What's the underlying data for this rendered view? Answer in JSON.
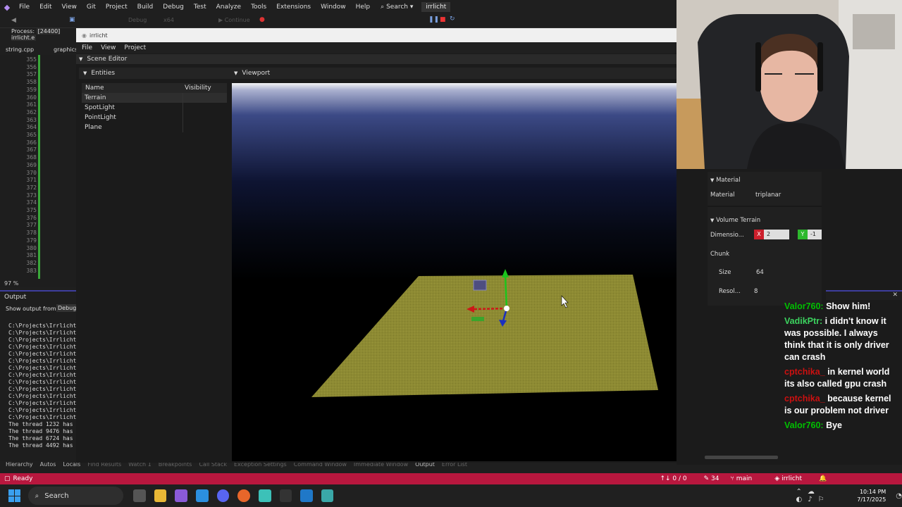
{
  "vs": {
    "menu": [
      "File",
      "Edit",
      "View",
      "Git",
      "Project",
      "Build",
      "Debug",
      "Test",
      "Analyze",
      "Tools",
      "Extensions",
      "Window",
      "Help"
    ],
    "search_label": "Search",
    "solution_name": "irrlicht",
    "config": "Debug",
    "platform": "x64",
    "continue_label": "Continue",
    "process_label": "Process:",
    "process_value": "[24400] irrlicht.e",
    "tabs": [
      "string.cpp",
      "graphics"
    ],
    "line_numbers": [
      "355",
      "356",
      "357",
      "358",
      "359",
      "360",
      "361",
      "362",
      "363",
      "364",
      "365",
      "366",
      "367",
      "368",
      "369",
      "370",
      "371",
      "372",
      "373",
      "374",
      "375",
      "376",
      "377",
      "378",
      "379",
      "380",
      "381",
      "382",
      "383"
    ],
    "zoom": "97 %",
    "output": {
      "title": "Output",
      "show_from_label": "Show output from:",
      "show_from_value": "Debug",
      "lines": [
        "C:\\Projects\\Irrlicht",
        "C:\\Projects\\Irrlicht",
        "C:\\Projects\\Irrlicht",
        "C:\\Projects\\Irrlicht",
        "C:\\Projects\\Irrlicht",
        "C:\\Projects\\Irrlicht",
        "C:\\Projects\\Irrlicht",
        "C:\\Projects\\Irrlicht",
        "C:\\Projects\\Irrlicht",
        "C:\\Projects\\Irrlicht",
        "C:\\Projects\\Irrlicht",
        "C:\\Projects\\Irrlicht",
        "C:\\Projects\\Irrlicht",
        "C:\\Projects\\Irrlicht",
        "The thread 1232 has",
        "The thread 9476 has",
        "The thread 6724 has",
        "The thread 4492 has"
      ]
    },
    "bottom_tabs": [
      "Hierarchy",
      "Autos",
      "Locals",
      "Find Results",
      "Watch 1",
      "Breakpoints",
      "Call Stack",
      "Exception Settings",
      "Command Window",
      "Immediate Window",
      "Output",
      "Error List"
    ],
    "status": {
      "ready": "Ready",
      "changes": "0 / 0",
      "pencil_count": "34",
      "branch": "main",
      "repo": "irrlicht"
    }
  },
  "app": {
    "title": "irrlicht",
    "menu": [
      "File",
      "View",
      "Project"
    ],
    "scene_editor": "Scene Editor",
    "entities": {
      "title": "Entities",
      "col_name": "Name",
      "col_visibility": "Visibility",
      "rows": [
        "Terrain",
        "SpotLight",
        "PointLight",
        "Plane"
      ]
    },
    "viewport_title": "Viewport"
  },
  "props": {
    "material_section": "Material",
    "material_label": "Material",
    "material_value": "triplanar",
    "volume_section": "Volume Terrain",
    "dimension_label": "Dimensio...",
    "dim_x_label": "X",
    "dim_x_value": "2",
    "dim_y_label": "Y",
    "dim_y_value": "-1",
    "chunk_label": "Chunk",
    "size_label": "Size",
    "size_value": "64",
    "resol_label": "Resol...",
    "resol_value": "8"
  },
  "chat": [
    {
      "user": "Valor760:",
      "color": "#00c000",
      "text": "Show him!"
    },
    {
      "user": "VadikPtr:",
      "color": "#3cd35f",
      "text": "i didn't know it was possible. I always think that it is only driver can crash"
    },
    {
      "user": "cptchika_",
      "color": "#cc1010",
      "text": "in kernel world its also called gpu crash"
    },
    {
      "user": "cptchika_",
      "color": "#cc1010",
      "text": "because kernel is our problem not driver"
    },
    {
      "user": "Valor760:",
      "color": "#00c000",
      "text": "Bye"
    }
  ],
  "taskbar": {
    "search": "Search",
    "time": "10:14 PM",
    "date": "7/17/2025"
  },
  "colors": {
    "accent_status": "#b8173e",
    "terrain": "#8d8a33",
    "x_axis": "#cc1818",
    "y_axis": "#1cc41c",
    "z_axis": "#1a2fbf"
  }
}
